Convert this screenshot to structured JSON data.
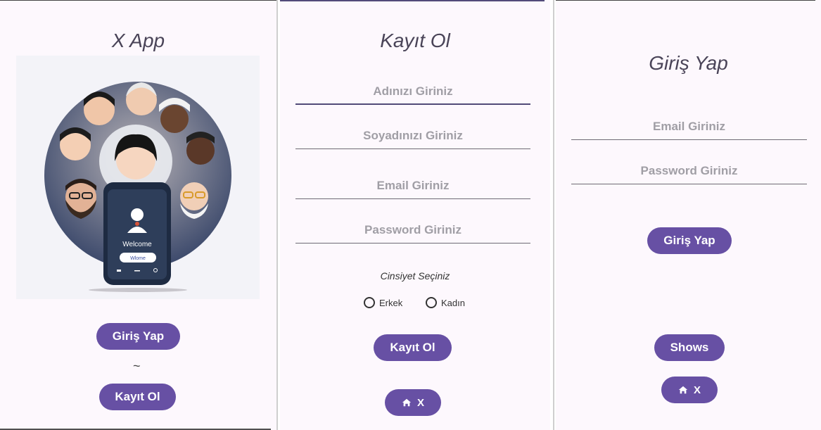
{
  "screens": {
    "welcome": {
      "title": "X App",
      "login_button": "Giriş Yap",
      "separator": "~",
      "register_button": "Kayıt Ol",
      "phone": {
        "welcome_text": "Welcome",
        "field_text": "Wlome"
      }
    },
    "register": {
      "title": "Kayıt Ol",
      "first_name_placeholder": "Adınızı Giriniz",
      "last_name_placeholder": "Soyadınızı Giriniz",
      "email_placeholder": "Email Giriniz",
      "password_placeholder": "Password Giriniz",
      "gender_label": "Cinsiyet Seçiniz",
      "gender_options": [
        "Erkek",
        "Kadın"
      ],
      "register_button": "Kayıt Ol",
      "home_button": "X"
    },
    "login": {
      "title": "Giriş Yap",
      "email_placeholder": "Email Giriniz",
      "password_placeholder": "Password Giriniz",
      "login_button": "Giriş Yap",
      "shows_button": "Shows",
      "home_button": "X"
    }
  },
  "colors": {
    "primary": "#6750a4",
    "background": "#fdf8fd",
    "title_text": "#4a4458",
    "placeholder_text": "#a09ea5"
  },
  "icons": {
    "home": "home-icon",
    "avatar": "user-icon"
  }
}
